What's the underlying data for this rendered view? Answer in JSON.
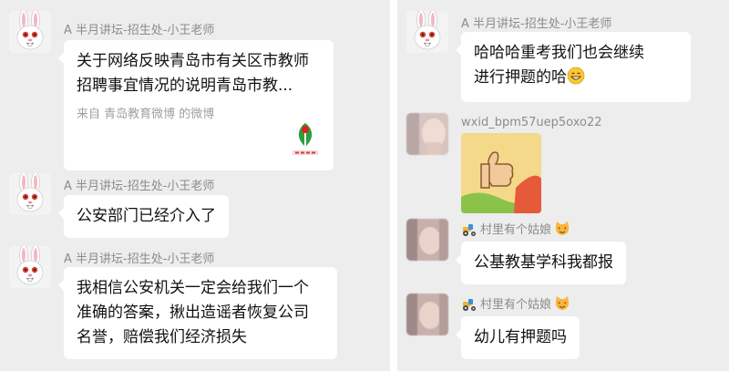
{
  "left_panel": {
    "messages": [
      {
        "sender": "A 半月讲坛-招生处-小王老师",
        "card": {
          "title": "关于网络反映青岛市有关区市教师招聘事宜情况的说明青岛市教...",
          "source": "来自 青岛教育微博 的微博",
          "logo_icon": "qingdao-education-logo"
        }
      },
      {
        "sender": "A 半月讲坛-招生处-小王老师",
        "text": "公安部门已经介入了"
      },
      {
        "sender": "A 半月讲坛-招生处-小王老师",
        "text_lines": [
          "我相信公安机关一定会给我们一个",
          "准确的答案，揪出造谣者恢复公司",
          "名誉，赔偿我们经济损失"
        ]
      }
    ]
  },
  "right_panel": {
    "messages": [
      {
        "sender": "A 半月讲坛-招生处-小王老师",
        "text_lines": [
          "哈哈哈重考我们也会继续",
          "进行押题的哈"
        ],
        "emoji": "grinning-face-icon"
      },
      {
        "sender": "wxid_bpm57uep5oxo22",
        "sticker": "thumbs-up-sticker"
      },
      {
        "sender": "村里有个姑娘",
        "sender_prefix_icon": "tractor-icon",
        "sender_suffix_icon": "heart-eyes-cat-icon",
        "text": "公基教基学科我都报"
      },
      {
        "sender": "村里有个姑娘",
        "sender_prefix_icon": "tractor-icon",
        "sender_suffix_icon": "heart-eyes-cat-icon",
        "text": "幼儿有押题吗"
      }
    ]
  },
  "colors": {
    "chat_background": "#ededed",
    "bubble": "#ffffff",
    "sender_text": "#8c8c8c",
    "logo_green": "#2e9e3e",
    "logo_red": "#e02020"
  }
}
